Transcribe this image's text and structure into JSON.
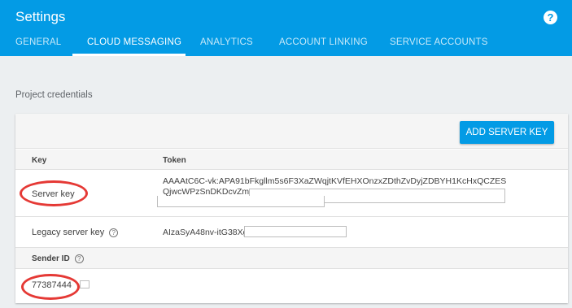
{
  "header": {
    "title": "Settings",
    "help_icon": "?"
  },
  "tabs": [
    {
      "label": "GENERAL",
      "active": false
    },
    {
      "label": "CLOUD MESSAGING",
      "active": true
    },
    {
      "label": "ANALYTICS",
      "active": false
    },
    {
      "label": "ACCOUNT LINKING",
      "active": false
    },
    {
      "label": "SERVICE ACCOUNTS",
      "active": false
    }
  ],
  "section": {
    "title": "Project credentials"
  },
  "card": {
    "add_button": "ADD SERVER KEY",
    "table": {
      "headers": {
        "key": "Key",
        "token": "Token"
      },
      "rows": [
        {
          "key": "Server key",
          "token_line1": "AAAAtC6C-vk:APA91bFkgllm5s6F3XaZWqjtKVfEHXOnzxZDthZvDyjZDBYH1KcHxQCZES",
          "token_line2": "QjwcWPzSnDKDcvZmv"
        },
        {
          "key": "Legacy server key",
          "token": "AIzaSyA48nv-itG38Xg"
        }
      ]
    },
    "sender": {
      "label": "Sender ID",
      "value": "77387444"
    }
  },
  "colors": {
    "header": "#039be5",
    "button": "#039be5",
    "annotation": "#e53935",
    "background": "#eceff1"
  }
}
